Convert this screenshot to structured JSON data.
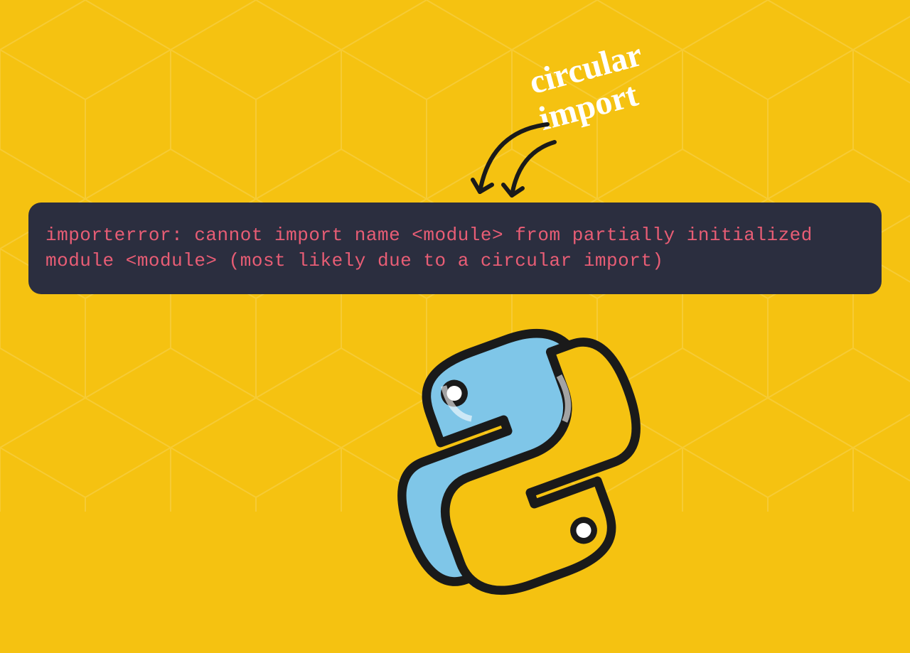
{
  "annotation": {
    "line1": "circular",
    "line2": "import"
  },
  "error_message": "importerror: cannot import name <module> from partially initialized module <module> (most likely due to a circular import)",
  "colors": {
    "background": "#f5c211",
    "error_box_bg": "#2b2e3f",
    "error_text": "#e85d75",
    "annotation_text": "#ffffff",
    "python_blue": "#7fc6e8",
    "python_yellow": "#f5c211",
    "outline": "#1a1a1a"
  }
}
